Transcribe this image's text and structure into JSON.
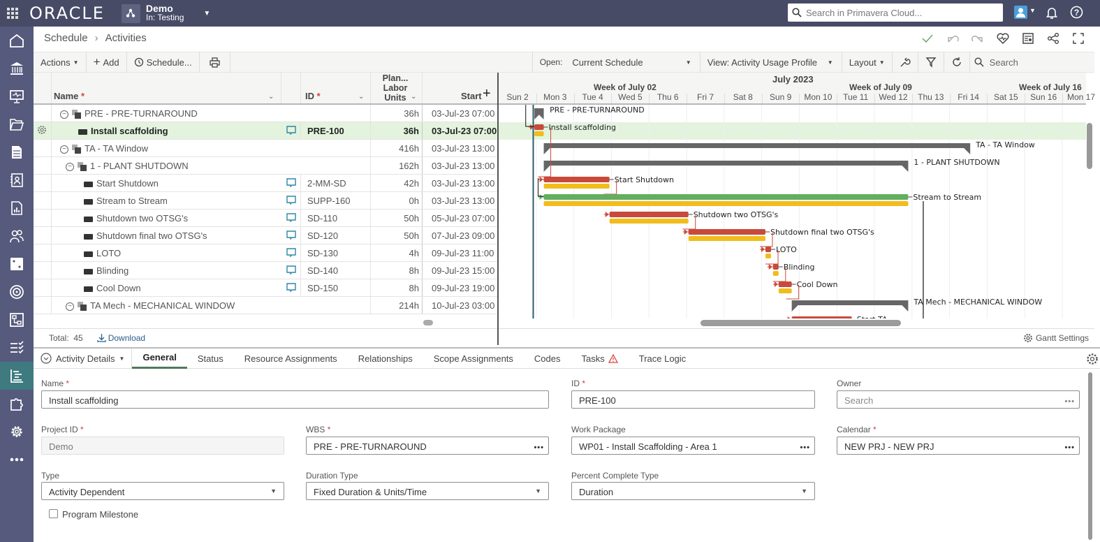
{
  "app": {
    "brand": "ORACLE",
    "project_name": "Demo",
    "project_context": "In: Testing",
    "global_search_placeholder": "Search in Primavera Cloud..."
  },
  "sidebar": {
    "items": [
      {
        "icon": "home-icon"
      },
      {
        "icon": "portfolio-icon"
      },
      {
        "icon": "dashboard-icon"
      },
      {
        "icon": "folder-icon"
      },
      {
        "icon": "document-icon"
      },
      {
        "icon": "contacts-icon"
      },
      {
        "icon": "report-icon"
      },
      {
        "icon": "users-icon"
      },
      {
        "icon": "dice-icon"
      },
      {
        "icon": "target-icon"
      },
      {
        "icon": "workflow-icon"
      },
      {
        "icon": "checklist-icon"
      },
      {
        "icon": "schedule-icon",
        "active": true
      },
      {
        "icon": "puzzle-icon"
      },
      {
        "icon": "settings-icon"
      },
      {
        "icon": "more-icon"
      }
    ]
  },
  "breadcrumb": {
    "parent": "Schedule",
    "separator": "›",
    "current": "Activities"
  },
  "toolbar": {
    "actions_label": "Actions",
    "add_label": "Add",
    "schedule_label": "Schedule...",
    "open_label": "Open:",
    "open_value": "Current Schedule",
    "view_label": "View: Activity Usage Profile",
    "layout_label": "Layout",
    "search_placeholder": "Search"
  },
  "grid": {
    "columns": {
      "name": "Name",
      "id": "ID",
      "units_line1": "Plan...",
      "units_line2": "Labor",
      "units_line3": "Units",
      "start": "Start"
    },
    "rows": [
      {
        "type": "wbs",
        "indent": 1,
        "name": "PRE - PRE-TURNAROUND",
        "id": "",
        "units": "36h",
        "start": "03-Jul-23 07:00"
      },
      {
        "type": "activity",
        "indent": 2,
        "name": "Install scaffolding",
        "id": "PRE-100",
        "units": "36h",
        "start": "03-Jul-23 07:00",
        "selected": true
      },
      {
        "type": "wbs",
        "indent": 1,
        "name": "TA - TA Window",
        "id": "",
        "units": "416h",
        "start": "03-Jul-23 13:00"
      },
      {
        "type": "wbs",
        "indent": 2,
        "name": "1 - PLANT SHUTDOWN",
        "id": "",
        "units": "162h",
        "start": "03-Jul-23 13:00"
      },
      {
        "type": "activity",
        "indent": 3,
        "name": "Start Shutdown",
        "id": "2-MM-SD",
        "units": "42h",
        "start": "03-Jul-23 13:00"
      },
      {
        "type": "activity",
        "indent": 3,
        "name": "Stream to Stream",
        "id": "SUPP-160",
        "units": "0h",
        "start": "03-Jul-23 13:00"
      },
      {
        "type": "activity",
        "indent": 3,
        "name": "Shutdown two OTSG's",
        "id": "SD-110",
        "units": "50h",
        "start": "05-Jul-23 07:00"
      },
      {
        "type": "activity",
        "indent": 3,
        "name": "Shutdown final two OTSG's",
        "id": "SD-120",
        "units": "50h",
        "start": "07-Jul-23 09:00"
      },
      {
        "type": "activity",
        "indent": 3,
        "name": "LOTO",
        "id": "SD-130",
        "units": "4h",
        "start": "09-Jul-23 11:00"
      },
      {
        "type": "activity",
        "indent": 3,
        "name": "Blinding",
        "id": "SD-140",
        "units": "8h",
        "start": "09-Jul-23 15:00"
      },
      {
        "type": "activity",
        "indent": 3,
        "name": "Cool Down",
        "id": "SD-150",
        "units": "8h",
        "start": "09-Jul-23 19:00"
      },
      {
        "type": "wbs",
        "indent": 2,
        "name": "TA Mech - MECHANICAL WINDOW",
        "id": "",
        "units": "214h",
        "start": "10-Jul-23 03:00"
      }
    ],
    "total_label": "Total:",
    "total_value": "45",
    "download_label": "Download"
  },
  "gantt": {
    "month": "July 2023",
    "weeks": [
      "Week of July 02",
      "Week of July 09",
      "Week of July 16"
    ],
    "days": [
      "Sun 2",
      "Mon 3",
      "Tue 4",
      "Wed 5",
      "Thu 6",
      "Fri 7",
      "Sat 8",
      "Sun 9",
      "Mon 10",
      "Tue 11",
      "Wed 12",
      "Thu 13",
      "Fri 14",
      "Sat 15",
      "Sun 16",
      "Mon 17"
    ],
    "bars": [
      {
        "label": "PRE - PRE-TURNAROUND",
        "kind": "summary",
        "start_day": 0.95,
        "end_day": 1.2
      },
      {
        "label": "Install scaffolding",
        "kind": "activity",
        "start_day": 0.95,
        "end_day": 1.2
      },
      {
        "label": "TA - TA Window",
        "kind": "summary",
        "start_day": 1.2,
        "end_day": 12.55
      },
      {
        "label": "1 - PLANT SHUTDOWN",
        "kind": "summary",
        "start_day": 1.2,
        "end_day": 10.9
      },
      {
        "label": "Start Shutdown",
        "kind": "activity",
        "start_day": 1.2,
        "end_day": 2.95
      },
      {
        "label": "Stream to Stream",
        "kind": "level-of-effort",
        "start_day": 1.2,
        "end_day": 10.9
      },
      {
        "label": "Shutdown two OTSG's",
        "kind": "activity",
        "start_day": 2.95,
        "end_day": 5.05
      },
      {
        "label": "Shutdown final two OTSG's",
        "kind": "activity",
        "start_day": 5.05,
        "end_day": 7.1
      },
      {
        "label": "LOTO",
        "kind": "activity",
        "start_day": 7.1,
        "end_day": 7.25
      },
      {
        "label": "Blinding",
        "kind": "activity",
        "start_day": 7.3,
        "end_day": 7.45
      },
      {
        "label": "Cool Down",
        "kind": "activity",
        "start_day": 7.45,
        "end_day": 7.8
      },
      {
        "label": "TA Mech - MECHANICAL WINDOW",
        "kind": "summary",
        "start_day": 7.8,
        "end_day": 10.9
      },
      {
        "label": "Start TA",
        "kind": "activity",
        "start_day": 7.8,
        "end_day": 9.4
      }
    ],
    "settings_label": "Gantt Settings",
    "colors": {
      "activity": "#c9493a",
      "baseline": "#f0bd1c",
      "loe": "#63ae60",
      "summary": "#666666",
      "selected_row": "#e3f3de"
    }
  },
  "details": {
    "panel_label": "Activity Details",
    "tabs": [
      "General",
      "Status",
      "Resource Assignments",
      "Relationships",
      "Scope Assignments",
      "Codes",
      "Tasks",
      "Trace Logic"
    ],
    "active_tab": "General",
    "fields": {
      "name": {
        "label": "Name",
        "value": "Install scaffolding"
      },
      "id": {
        "label": "ID",
        "value": "PRE-100"
      },
      "owner": {
        "label": "Owner",
        "placeholder": "Search"
      },
      "project_id": {
        "label": "Project ID",
        "value": "Demo"
      },
      "wbs": {
        "label": "WBS",
        "value": "PRE - PRE-TURNAROUND"
      },
      "work_package": {
        "label": "Work Package",
        "value": "WP01 - Install Scaffolding - Area 1"
      },
      "calendar": {
        "label": "Calendar",
        "value": "NEW PRJ - NEW PRJ"
      },
      "type": {
        "label": "Type",
        "value": "Activity Dependent"
      },
      "duration_type": {
        "label": "Duration Type",
        "value": "Fixed Duration & Units/Time"
      },
      "percent_complete_type": {
        "label": "Percent Complete Type",
        "value": "Duration"
      },
      "program_milestone": {
        "label": "Program Milestone",
        "checked": false
      }
    },
    "required_marker": "*"
  }
}
